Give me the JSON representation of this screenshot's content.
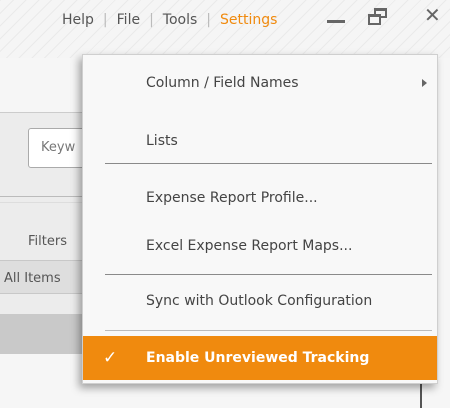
{
  "menubar": {
    "items": [
      "Help",
      "File",
      "Tools",
      "Settings"
    ],
    "separator": "|",
    "active_color": "#f08a0e"
  },
  "window_controls": {
    "minimize_icon": "minimize-icon",
    "restore_icon": "restore-icon",
    "close_icon": "close-icon",
    "close_glyph": "✕"
  },
  "background": {
    "keyword_field_text": "Keyw",
    "filters_label": "Filters",
    "all_items_label": "All Items"
  },
  "settings_menu": {
    "items": [
      {
        "label": "Column / Field Names",
        "has_submenu": true
      },
      {
        "label": "Lists"
      },
      {
        "label": "Expense Report Profile..."
      },
      {
        "label": "Excel Expense Report Maps..."
      },
      {
        "label": "Sync with Outlook Configuration"
      },
      {
        "label": "Enable Unreviewed Tracking",
        "checked": true
      }
    ],
    "check_glyph": "✓",
    "highlight_color": "#f08a0e"
  }
}
